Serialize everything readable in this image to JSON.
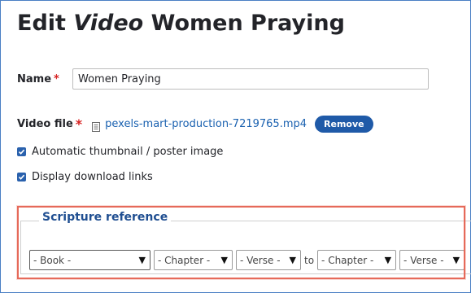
{
  "page": {
    "title_prefix": "Edit",
    "title_type": "Video",
    "title_name": "Women Praying"
  },
  "form": {
    "name_label": "Name",
    "required_marker": "*",
    "name_value": "Women Praying",
    "video_file_label": "Video file",
    "video_file_name": "pexels-mart-production-7219765.mp4",
    "remove_label": "Remove",
    "auto_thumbnail_label": "Automatic thumbnail / poster image",
    "auto_thumbnail_checked": true,
    "download_links_label": "Display download links",
    "download_links_checked": true
  },
  "scripture": {
    "legend": "Scripture reference",
    "book_selected": "- Book -",
    "chapter_selected": "- Chapter -",
    "verse_selected": "- Verse -",
    "to_label": "to",
    "end_chapter_selected": "- Chapter -",
    "end_verse_selected": "- Verse -"
  },
  "colors": {
    "accent": "#1f5aa8",
    "highlight": "#e66a5a",
    "required": "#d72222",
    "legend": "#1f4e91"
  },
  "icons": {
    "dropdown": "▼",
    "checkmark": "check-icon",
    "file": "file-icon"
  }
}
